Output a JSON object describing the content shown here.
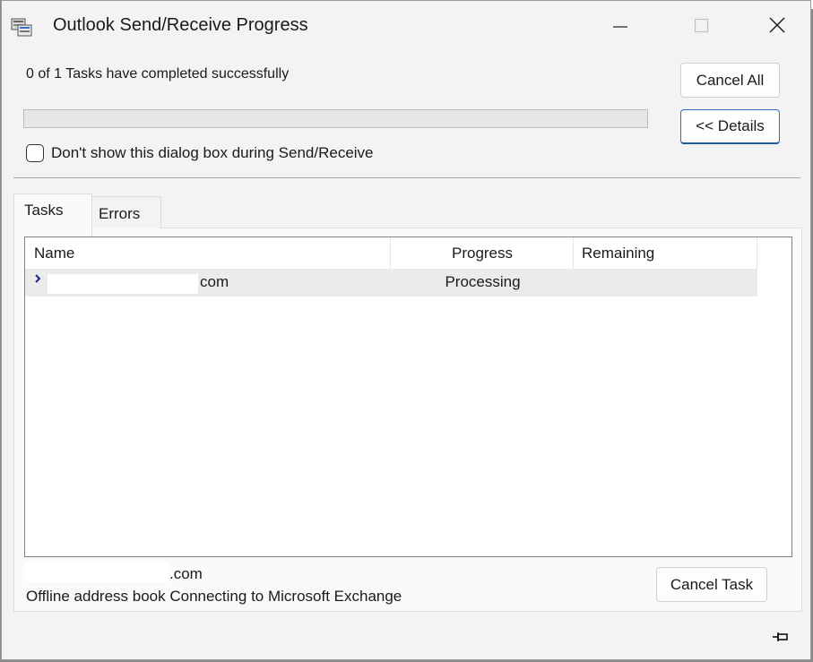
{
  "window": {
    "title": "Outlook Send/Receive Progress",
    "minimize_icon": "minimize-icon",
    "maximize_icon": "maximize-icon",
    "close_icon": "close-icon"
  },
  "status_text": "0 of 1 Tasks have completed successfully",
  "progress_fraction": 0,
  "buttons": {
    "cancel_all": "Cancel All",
    "details": "<< Details",
    "cancel_task": "Cancel Task"
  },
  "checkbox": {
    "label": "Don't show this dialog box during Send/Receive",
    "checked": false
  },
  "tabs": [
    {
      "label": "Tasks",
      "active": true
    },
    {
      "label": "Errors",
      "active": false
    }
  ],
  "task_list": {
    "columns": [
      "Name",
      "Progress",
      "Remaining"
    ],
    "rows": [
      {
        "name": "com",
        "progress": "Processing",
        "remaining": "",
        "icon": "sync-arrow-icon"
      }
    ]
  },
  "footer": {
    "account": ".com",
    "status": "Offline address book Connecting to Microsoft Exchange",
    "pin_icon": "pin-icon"
  },
  "colors": {
    "dialog_bg": "#f3f3f3",
    "accent_border": "#2b6cc4"
  }
}
